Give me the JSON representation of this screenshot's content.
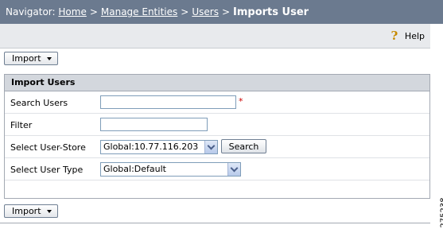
{
  "navigator": {
    "prefix": "Navigator:",
    "crumbs": [
      "Home",
      "Manage Entities",
      "Users"
    ],
    "separator": ">",
    "current": "Imports User"
  },
  "help": {
    "label": "Help",
    "icon": "help-question-icon"
  },
  "toolbar": {
    "import_label": "Import"
  },
  "panel": {
    "title": "Import Users",
    "search_users_label": "Search Users",
    "search_users_value": "",
    "required_marker": "*",
    "filter_label": "Filter",
    "filter_value": "",
    "user_store_label": "Select User-Store",
    "user_store_value": "Global:10.77.116.203",
    "search_button": "Search",
    "user_type_label": "Select User Type",
    "user_type_value": "Global:Default"
  },
  "figure_id": "275238",
  "colors": {
    "nav_bg": "#6b7a8f",
    "panel_head_bg": "#d3d7dd",
    "required": "#cc0000"
  }
}
